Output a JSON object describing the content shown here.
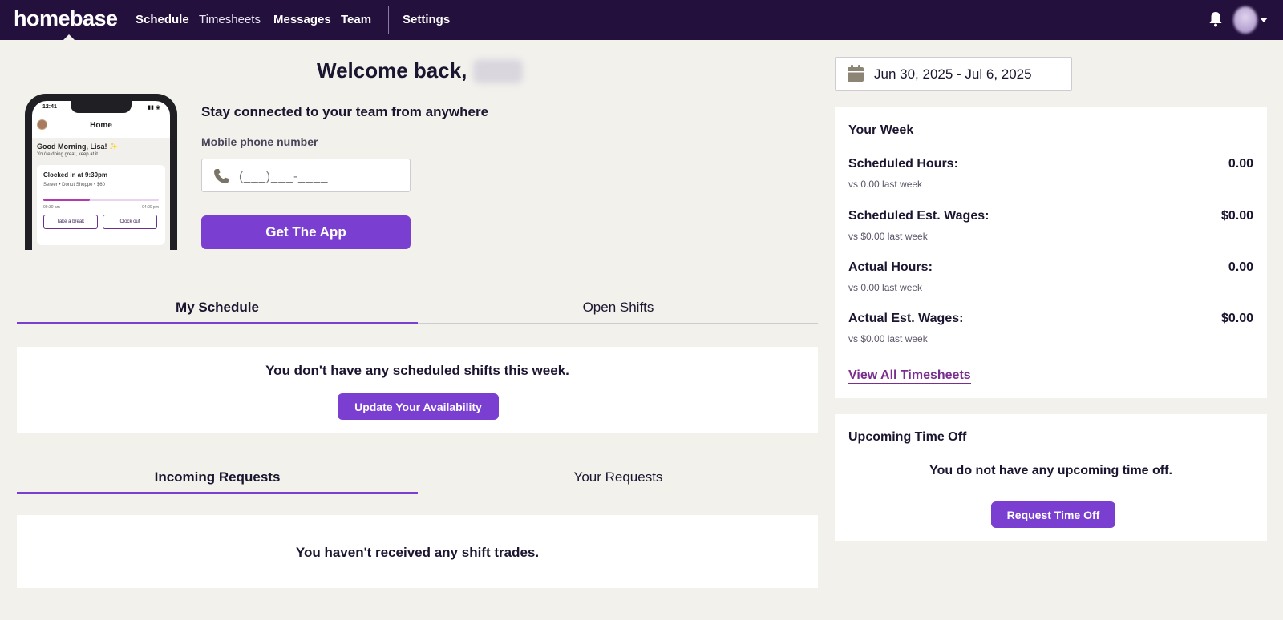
{
  "nav": {
    "logo": "homebase",
    "links": [
      "Schedule",
      "Timesheets",
      "Messages",
      "Team"
    ],
    "settings": "Settings"
  },
  "welcome": {
    "heading": "Welcome back,",
    "tagline": "Stay connected to your team from anywhere",
    "phone_label": "Mobile phone number",
    "phone_placeholder": "(___)___-____",
    "get_app": "Get The App"
  },
  "phone_mock": {
    "time": "12:41",
    "title": "Home",
    "greeting": "Good Morning, Lisa! ✨",
    "subtext": "You're doing great, keep at it",
    "clocked": "Clocked in at 9:30pm",
    "role": "Server • Donut Shoppe • $60",
    "start": "09:30 am",
    "end": "04:00 pm",
    "break_btn": "Take a break",
    "clockout_btn": "Clock out",
    "progress": 0.4
  },
  "schedule_tabs": {
    "tabs": [
      "My Schedule",
      "Open Shifts"
    ],
    "active": 0,
    "empty_text": "You don't have any scheduled shifts this week.",
    "button": "Update Your Availability"
  },
  "request_tabs": {
    "tabs": [
      "Incoming Requests",
      "Your Requests"
    ],
    "active": 0,
    "empty_text": "You haven't received any shift trades."
  },
  "date_range": "Jun 30, 2025 - Jul 6, 2025",
  "your_week": {
    "title": "Your Week",
    "stats": [
      {
        "label": "Scheduled Hours:",
        "value": "0.00",
        "compare": "vs 0.00 last week"
      },
      {
        "label": "Scheduled Est. Wages:",
        "value": "$0.00",
        "compare": "vs $0.00 last week"
      },
      {
        "label": "Actual Hours:",
        "value": "0.00",
        "compare": "vs 0.00 last week"
      },
      {
        "label": "Actual Est. Wages:",
        "value": "$0.00",
        "compare": "vs $0.00 last week"
      }
    ],
    "link": "View All Timesheets"
  },
  "time_off": {
    "title": "Upcoming Time Off",
    "empty_text": "You do not have any upcoming time off.",
    "button": "Request Time Off"
  },
  "colors": {
    "nav_bg": "#23103c",
    "accent": "#7a3fd1",
    "link": "#7a2e8e",
    "page_bg": "#f2f1ec"
  }
}
